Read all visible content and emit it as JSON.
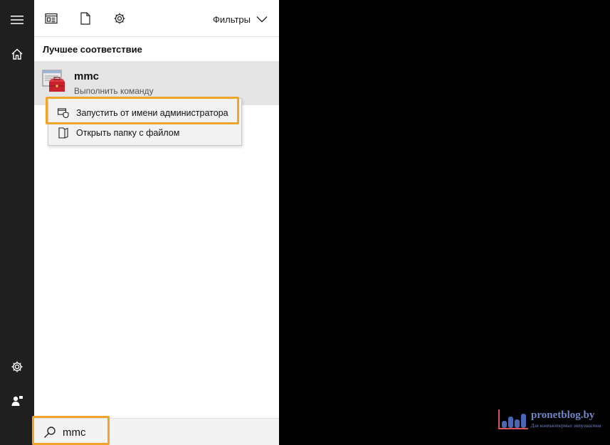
{
  "rail": {
    "items": [
      {
        "icon": "hamburger-menu-icon"
      },
      {
        "icon": "home-icon"
      },
      {
        "icon": "settings-gear-icon"
      },
      {
        "icon": "feedback-person-icon"
      }
    ]
  },
  "topbar": {
    "icons": [
      "apps-icon",
      "documents-icon",
      "web-settings-icon"
    ],
    "filters_label": "Фильтры"
  },
  "results": {
    "section_title": "Лучшее соответствие",
    "best_match": {
      "name": "mmc",
      "subtitle": "Выполнить команду",
      "icon": "mmc-console-icon"
    }
  },
  "context_menu": {
    "items": [
      {
        "label": "Запустить от имени администратора",
        "icon": "run-as-admin-shield-icon",
        "highlighted": true
      },
      {
        "label": "Открыть папку с файлом",
        "icon": "open-folder-icon",
        "highlighted": false
      }
    ]
  },
  "search": {
    "value": "mmc",
    "placeholder": ""
  },
  "watermark": {
    "title": "pronetblog.by",
    "subtitle": "Для компьютерных энтузиастов"
  },
  "colors": {
    "rail_bg": "#1f1f1f",
    "panel_bg": "#ffffff",
    "selected_bg": "#e5e5e5",
    "highlight_box": "#f0a52a",
    "desktop_bg": "#000000"
  }
}
